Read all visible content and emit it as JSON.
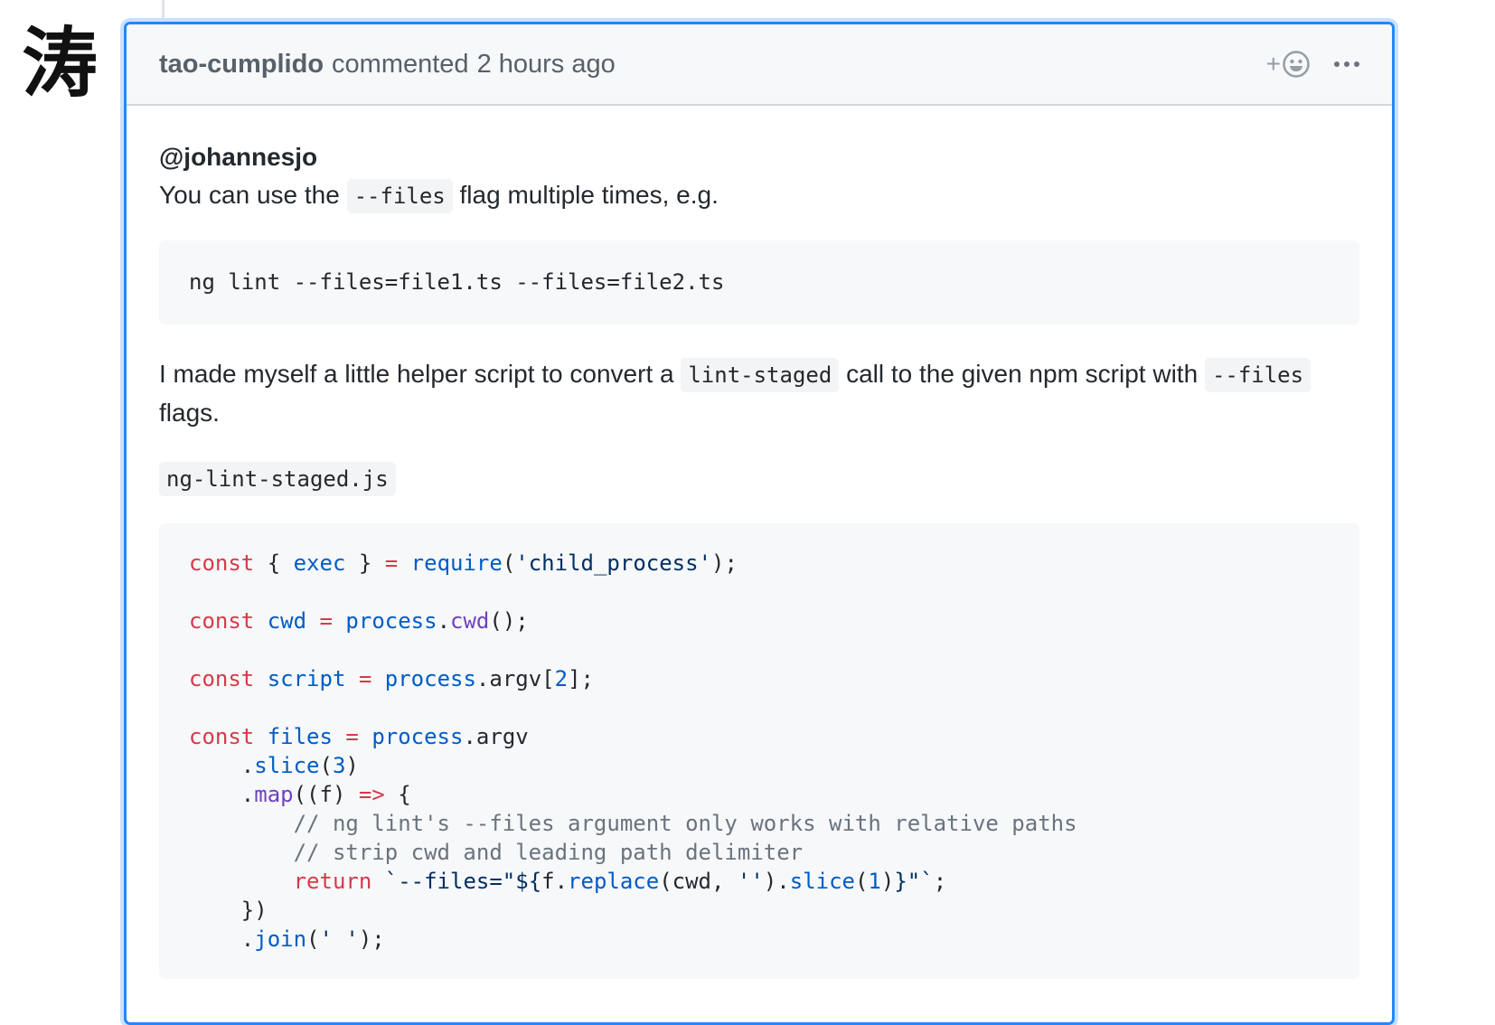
{
  "avatar": {
    "glyph": "涛"
  },
  "comment": {
    "author": "tao-cumplido",
    "action": "commented",
    "time": "2 hours ago",
    "reaction_plus": "+"
  },
  "body": {
    "mention": "@johannesjo",
    "p1": {
      "before": "You can use the ",
      "code": "--files",
      "after": " flag multiple times, e.g."
    },
    "command": "ng lint --files=file1.ts --files=file2.ts",
    "p2": {
      "a": "I made myself a little helper script to convert a ",
      "code1": "lint-staged",
      "b": " call to the given npm script with ",
      "code2": "--files",
      "c": " flags."
    },
    "filename": "ng-lint-staged.js",
    "code": {
      "l1": {
        "k": "const",
        "a": " { ",
        "b": "exec",
        "c": " } ",
        "d": "=",
        "e": " ",
        "f": "require",
        "g": "(",
        "h": "'child_process'",
        "i": ");"
      },
      "l3": {
        "k": "const",
        "a": " ",
        "b": "cwd",
        "c": " ",
        "d": "=",
        "e": " ",
        "f": "process",
        "g": ".",
        "h": "cwd",
        "i": "();"
      },
      "l5": {
        "k": "const",
        "a": " ",
        "b": "script",
        "c": " ",
        "d": "=",
        "e": " ",
        "f": "process",
        "g": ".argv[",
        "h": "2",
        "i": "];"
      },
      "l7": {
        "k": "const",
        "a": " ",
        "b": "files",
        "c": " ",
        "d": "=",
        "e": " ",
        "f": "process",
        "g": ".argv"
      },
      "l8": {
        "a": "    .",
        "b": "slice",
        "c": "(",
        "d": "3",
        "e": ")"
      },
      "l9": {
        "a": "    .",
        "b": "map",
        "c": "((f) ",
        "d": "=>",
        "e": " {"
      },
      "l10": "        // ng lint's --files argument only works with relative paths",
      "l11": "        // strip cwd and leading path delimiter",
      "l12": {
        "ind": "        ",
        "k": "return",
        "a": " ",
        "b": "`--files=\"${",
        "c": "f.",
        "d": "replace",
        "e": "(cwd, ",
        "f": "''",
        "g": ").",
        "h": "slice",
        "i": "(",
        "j": "1",
        "l": ")",
        "m": "}\"`",
        "n": ";"
      },
      "l13": "    })",
      "l14": {
        "a": "    .",
        "b": "join",
        "c": "(",
        "d": "' '",
        "e": ");"
      }
    }
  },
  "colors": {
    "border_focus": "#2188ff",
    "keyword": "#d73a49",
    "entity": "#005cc5",
    "function": "#6f42c1",
    "string": "#032f62",
    "comment": "#6a737d"
  },
  "icons": {
    "reaction": "smiley-icon",
    "menu": "kebab-horizontal-icon"
  }
}
